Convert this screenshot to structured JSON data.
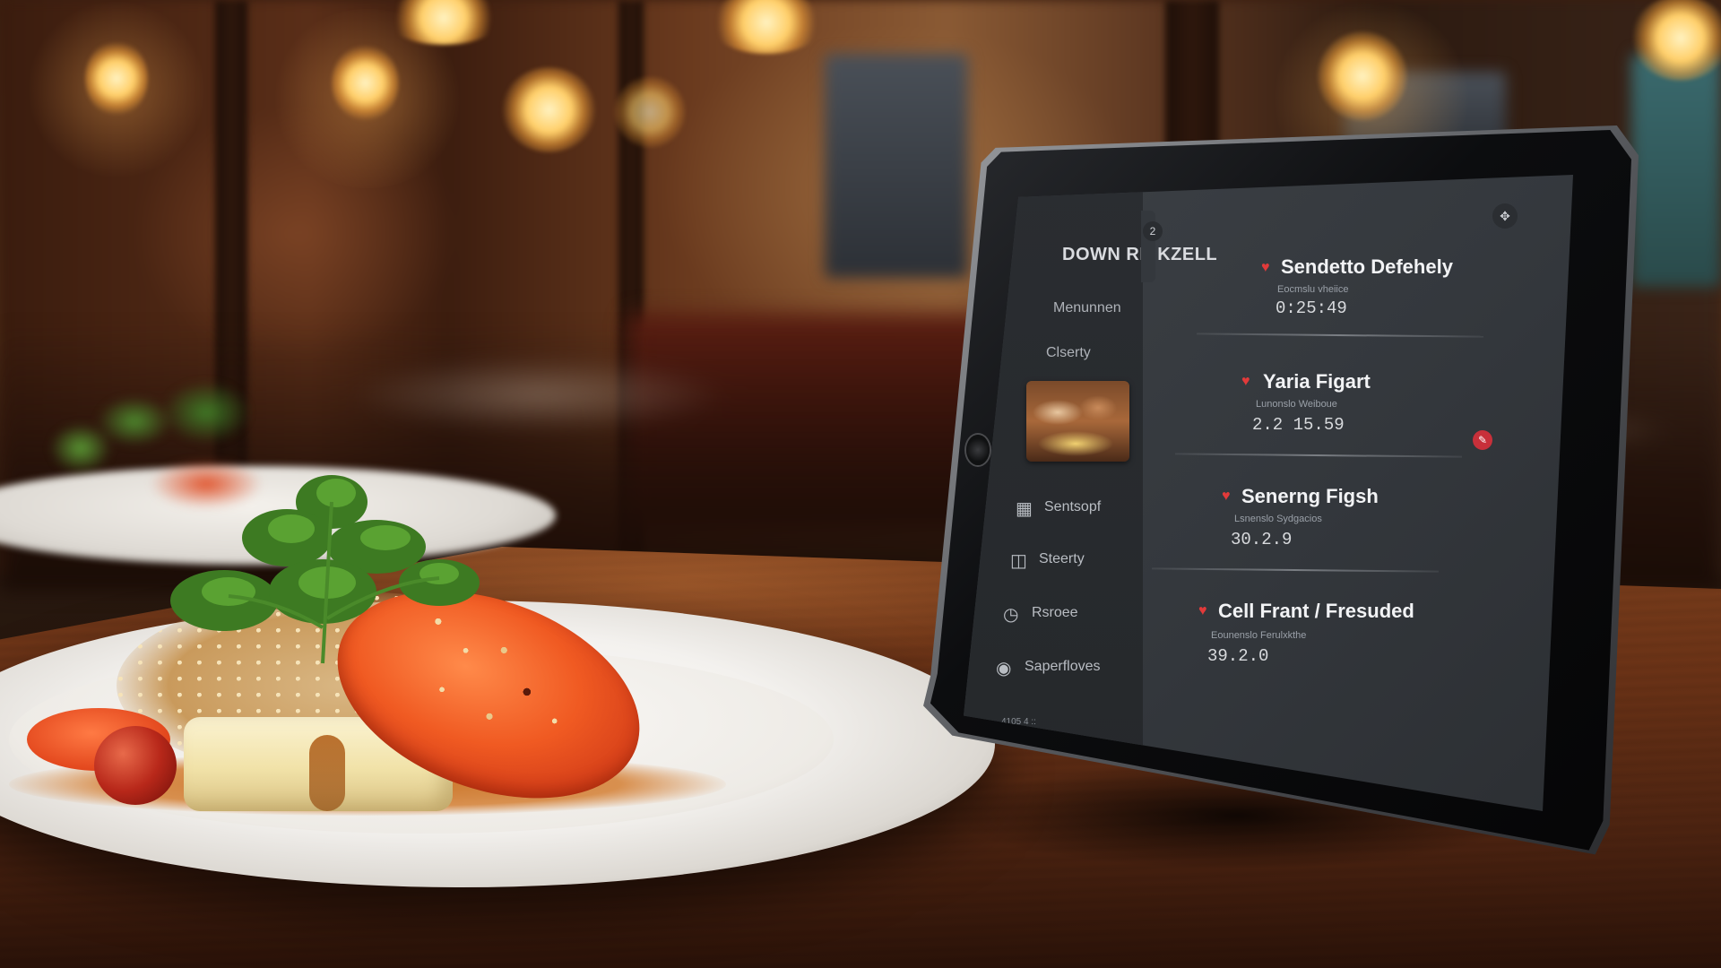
{
  "app": {
    "brand": "DOWN RE KZELL"
  },
  "sidebar": {
    "menu_label": "Menunnen",
    "section_label": "Clserty",
    "items": [
      {
        "label": "Sentsopf",
        "icon": "grid-icon"
      },
      {
        "label": "Steerty",
        "icon": "bag-icon"
      },
      {
        "label": "Rsroee",
        "icon": "clock-icon"
      },
      {
        "label": "Saperfloves",
        "icon": "person-icon"
      }
    ],
    "collapse_badge": "2"
  },
  "header": {
    "corner_icon": "settings-icon"
  },
  "orders": [
    {
      "title": "Sendetto Defehely",
      "subtitle": "Eocmslu vheiice",
      "time": "0:25:49"
    },
    {
      "title": "Yaria Figart",
      "subtitle": "Lunonslo Weiboue",
      "time": "2.2 15.59"
    },
    {
      "title": "Senerng Figsh",
      "subtitle": "Lsnenslo Sydgacios",
      "time": "30.2.9"
    },
    {
      "title": "Cell Frant / Fresuded",
      "subtitle": "Eounenslo Ferulxkthe",
      "time": "39.2.0"
    }
  ],
  "footer": {
    "status": "4105 4 ::"
  },
  "colors": {
    "accent": "#e23a3a",
    "screen_bg": "#3c4045",
    "sidebar_bg": "#2a2d31"
  }
}
